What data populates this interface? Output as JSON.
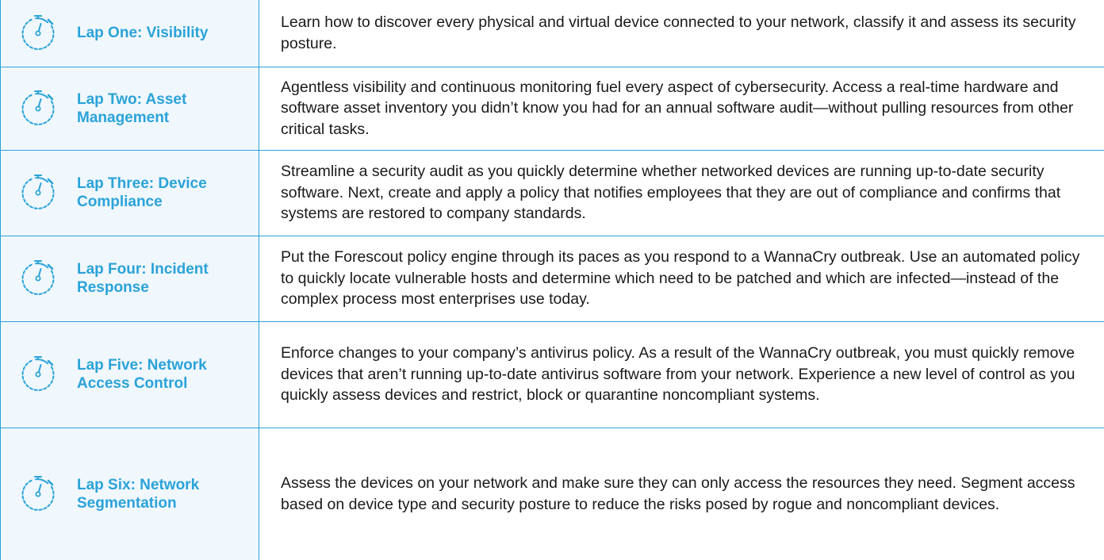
{
  "laps": [
    {
      "title": "Lap One: Visibility",
      "description": "Learn how to discover every physical and virtual device connected to your network, classify it and assess its security posture."
    },
    {
      "title": "Lap Two: Asset Management",
      "description": "Agentless visibility and continuous monitoring fuel every aspect of cybersecurity. Access a real-time hardware and software asset inventory you didn’t know you had for an annual software audit—without pulling resources from other critical tasks."
    },
    {
      "title": "Lap Three: Device Compliance",
      "description": "Streamline a security audit as you quickly determine whether networked devices are running up-to-date security software. Next, create and apply a policy that notifies employees that they are out of compliance and confirms that systems are restored to company standards."
    },
    {
      "title": "Lap Four: Incident Response",
      "description": "Put the Forescout policy engine through its paces as you respond to a WannaCry outbreak. Use an automated policy to quickly locate vulnerable hosts and determine which need to be patched and which are infected—instead of the complex process most enterprises use today."
    },
    {
      "title": "Lap Five: Network Access Control",
      "description": "Enforce changes to your company’s antivirus policy. As a result of the WannaCry outbreak, you must quickly remove devices that aren’t running up-to-date antivirus software from your network. Experience a new level of control as you quickly assess devices and restrict, block or quarantine noncompliant systems."
    },
    {
      "title": "Lap Six: Network Segmentation",
      "description": "Assess the devices on your network and make sure they can only access the resources they need. Segment access based on device type and security posture to reduce the risks posed by rogue and noncompliant devices."
    }
  ],
  "colors": {
    "accent": "#2aa3d9",
    "left_background": "#f0f7fd",
    "text": "#1a1a1a"
  },
  "icon": "stopwatch-icon"
}
